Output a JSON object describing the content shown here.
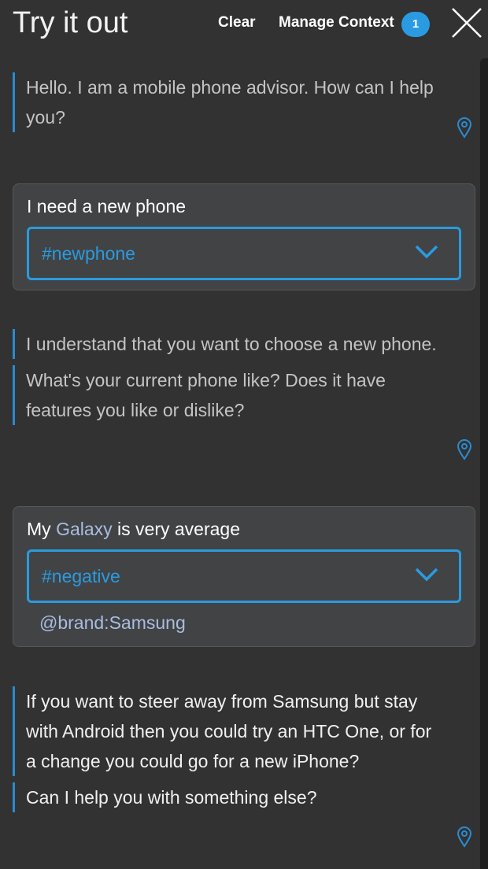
{
  "header": {
    "title": "Try it out",
    "clear_label": "Clear",
    "manage_context_label": "Manage Context",
    "context_count": "1",
    "close_icon": "close-icon"
  },
  "colors": {
    "accent": "#2a9be0",
    "background": "#323232",
    "card": "#414345",
    "entity": "#a9bde0"
  },
  "conversation": {
    "bot1": {
      "lines": [
        "Hello. I am a mobile phone advisor. How can I help you?"
      ]
    },
    "user1": {
      "text": "I need a new phone",
      "intent": "#newphone"
    },
    "bot2": {
      "lines": [
        "I understand that you want to choose a new phone.",
        "What's your current phone like? Does it have features you like or dislike?"
      ]
    },
    "user2": {
      "text_before": "My ",
      "entity_word": "Galaxy",
      "text_after": " is very average",
      "intent": "#negative",
      "entity": "@brand:Samsung"
    },
    "bot3": {
      "lines": [
        "If you want to steer away from Samsung but stay with Android then you could try an HTC One, or for a change you could go for a new iPhone?",
        "Can I help you with something else?"
      ]
    }
  }
}
